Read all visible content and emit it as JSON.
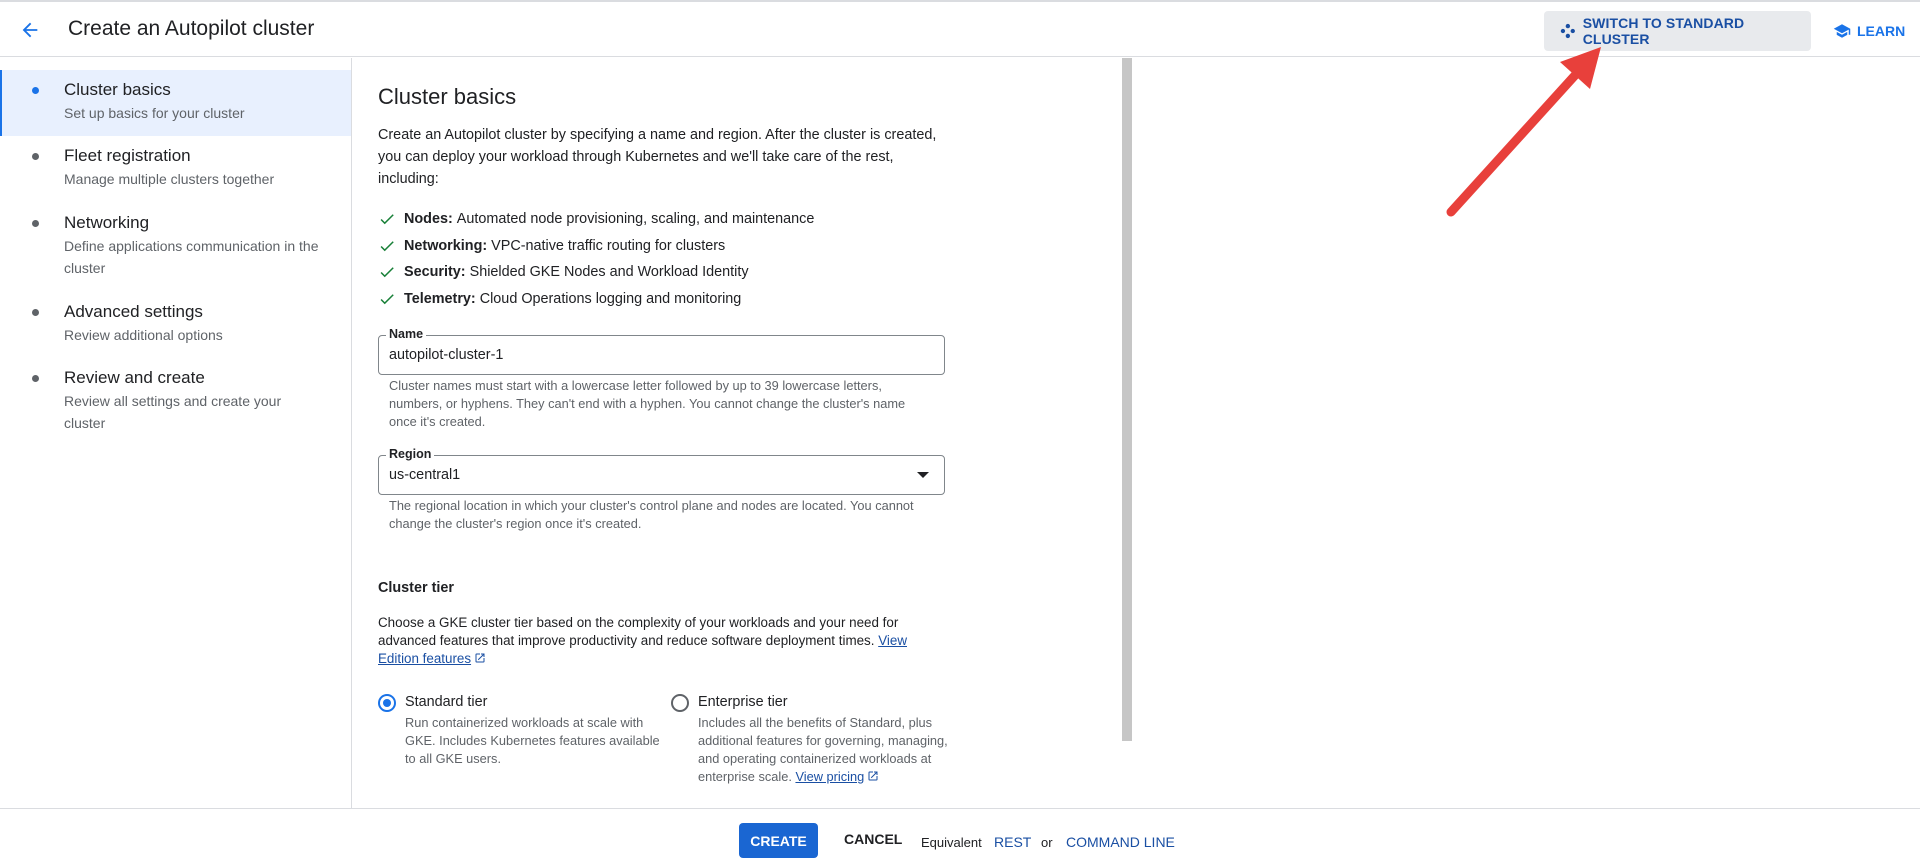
{
  "header": {
    "title": "Create an Autopilot cluster",
    "switch_label": "SWITCH TO STANDARD CLUSTER",
    "learn_label": "LEARN"
  },
  "sidebar": {
    "items": [
      {
        "title": "Cluster basics",
        "desc": "Set up basics for your cluster",
        "active": true
      },
      {
        "title": "Fleet registration",
        "desc": "Manage multiple clusters together"
      },
      {
        "title": "Networking",
        "desc": "Define applications communication in the cluster"
      },
      {
        "title": "Advanced settings",
        "desc": "Review additional options"
      },
      {
        "title": "Review and create",
        "desc": "Review all settings and create your cluster"
      }
    ]
  },
  "main": {
    "title": "Cluster basics",
    "intro": "Create an Autopilot cluster by specifying a name and region. After the cluster is created, you can deploy your workload through Kubernetes and we'll take care of the rest, including:",
    "features": [
      {
        "label": "Nodes:",
        "text": "Automated node provisioning, scaling, and maintenance"
      },
      {
        "label": "Networking:",
        "text": "VPC-native traffic routing for clusters"
      },
      {
        "label": "Security:",
        "text": "Shielded GKE Nodes and Workload Identity"
      },
      {
        "label": "Telemetry:",
        "text": "Cloud Operations logging and monitoring"
      }
    ],
    "name_field": {
      "label": "Name",
      "value": "autopilot-cluster-1",
      "hint": "Cluster names must start with a lowercase letter followed by up to 39 lowercase letters, numbers, or hyphens. They can't end with a hyphen. You cannot change the cluster's name once it's created."
    },
    "region_field": {
      "label": "Region",
      "value": "us-central1",
      "hint": "The regional location in which your cluster's control plane and nodes are located. You cannot change the cluster's region once it's created."
    },
    "tier": {
      "title": "Cluster tier",
      "intro": "Choose a GKE cluster tier based on the complexity of your workloads and your need for advanced features that improve productivity and reduce software deployment times.",
      "intro_link": "View Edition features",
      "options": [
        {
          "title": "Standard tier",
          "desc": "Run containerized workloads at scale with GKE. Includes Kubernetes features available to all GKE users.",
          "selected": true
        },
        {
          "title": "Enterprise tier",
          "desc": "Includes all the benefits of Standard, plus additional features for governing, managing, and operating containerized workloads at enterprise scale.",
          "link": "View pricing",
          "selected": false
        }
      ]
    }
  },
  "footer": {
    "create_label": "CREATE",
    "cancel_label": "CANCEL",
    "equivalent_label": "Equivalent",
    "rest_label": "REST",
    "or_label": "or",
    "command_line_label": "COMMAND LINE"
  },
  "colors": {
    "accent": "#1a73e8",
    "link": "#1a4fa3",
    "annotation_arrow": "#e8403b"
  }
}
